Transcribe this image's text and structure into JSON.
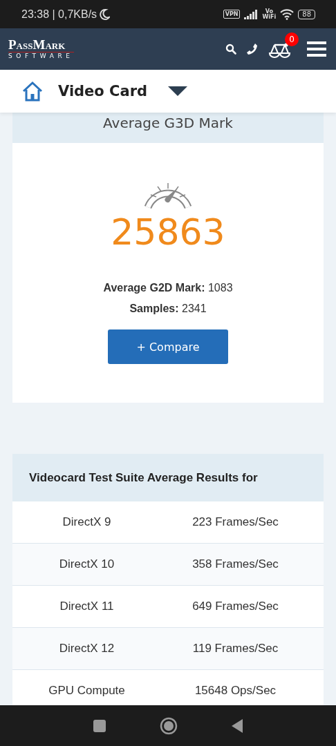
{
  "status_bar": {
    "time": "23:38 | 0,7KB/s",
    "vpn": "VPN",
    "vowifi_top": "Vo",
    "vowifi_bottom": "WiFi",
    "battery": "88"
  },
  "header": {
    "logo_top": "PassMark",
    "logo_bottom": "SOFTWARE",
    "compare_count": "0"
  },
  "breadcrumb": {
    "title": "Video Card"
  },
  "score_card": {
    "title": "Average G3D Mark",
    "score": "25863",
    "g2d_label": "Average G2D Mark:",
    "g2d_value": "1083",
    "samples_label": "Samples:",
    "samples_value": "2341",
    "button": "+ Compare"
  },
  "results_table": {
    "heading": "Videocard Test Suite Average Results for",
    "rows": [
      {
        "test": "DirectX 9",
        "result": "223 Frames/Sec"
      },
      {
        "test": "DirectX 10",
        "result": "358 Frames/Sec"
      },
      {
        "test": "DirectX 11",
        "result": "649 Frames/Sec"
      },
      {
        "test": "DirectX 12",
        "result": "119 Frames/Sec"
      },
      {
        "test": "GPU Compute",
        "result": "15648 Ops/Sec"
      }
    ]
  }
}
